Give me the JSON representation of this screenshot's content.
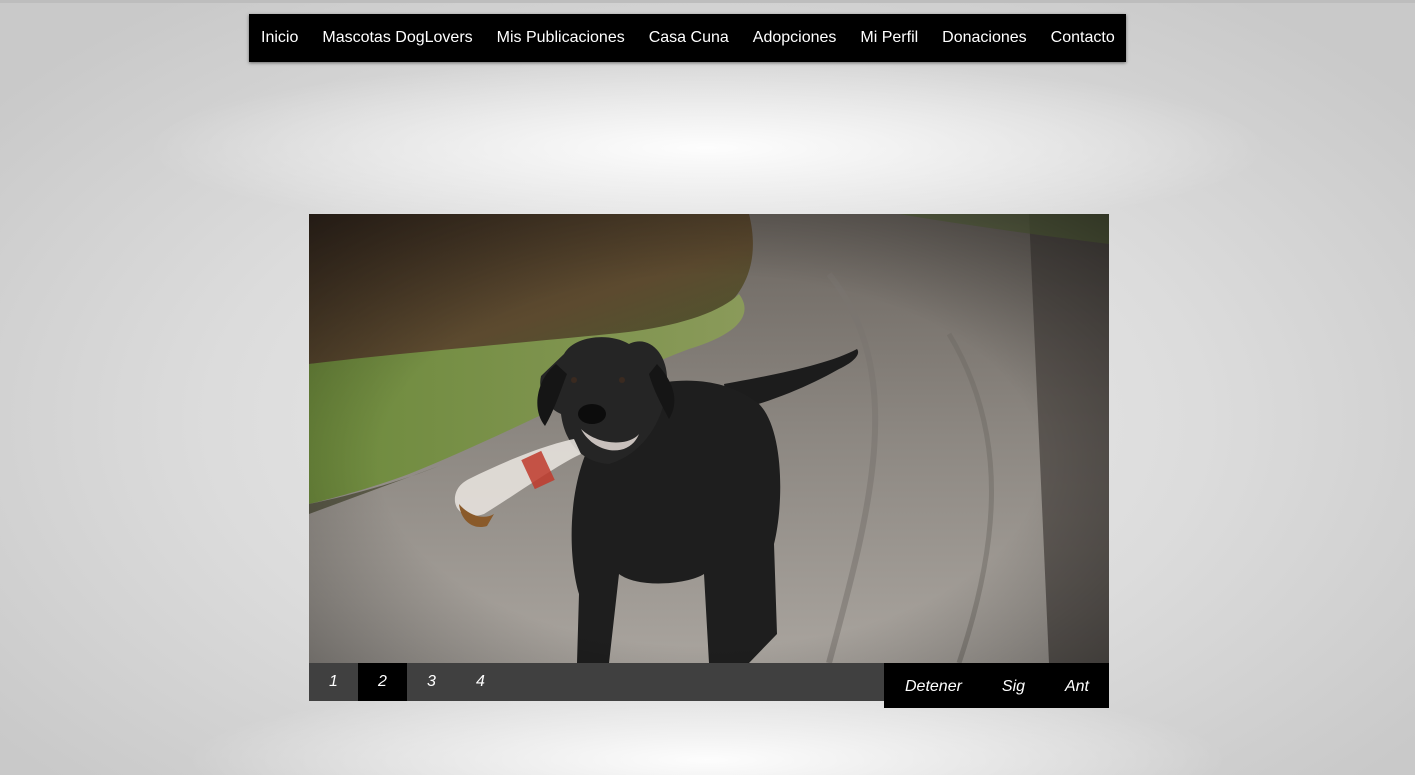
{
  "nav": {
    "items": [
      {
        "label": "Inicio"
      },
      {
        "label": "Mascotas DogLovers"
      },
      {
        "label": "Mis Publicaciones"
      },
      {
        "label": "Casa Cuna"
      },
      {
        "label": "Adopciones"
      },
      {
        "label": "Mi Perfil"
      },
      {
        "label": "Donaciones"
      },
      {
        "label": "Contacto"
      }
    ]
  },
  "slider": {
    "pager": [
      "1",
      "2",
      "3",
      "4"
    ],
    "active_page": "2",
    "controls": {
      "stop": "Detener",
      "next": "Sig",
      "prev": "Ant"
    }
  },
  "colors": {
    "navbar_bg": "#000000",
    "pager_bg": "#404040",
    "pager_active_bg": "#000000",
    "controls_bg": "#000000",
    "text": "#ffffff"
  }
}
